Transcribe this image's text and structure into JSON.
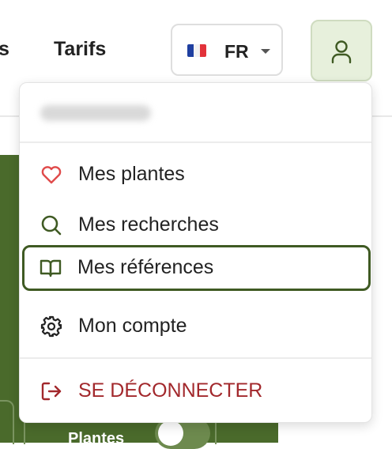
{
  "nav": {
    "partial_label": "s",
    "tarifs_label": "Tarifs"
  },
  "language": {
    "code": "FR"
  },
  "menu": {
    "items": [
      {
        "label": "Mes plantes",
        "icon": "heart-icon"
      },
      {
        "label": "Mes recherches",
        "icon": "search-icon"
      },
      {
        "label": "Mes références",
        "icon": "book-icon"
      },
      {
        "label": "Mon compte",
        "icon": "gear-icon"
      }
    ],
    "logout": {
      "label": "SE DÉCONNECTER",
      "icon": "logout-icon"
    }
  },
  "background": {
    "card_label": "Plantes"
  },
  "colors": {
    "brand_green": "#4a6a2b",
    "accent_dark_green": "#3f5a23",
    "danger_red": "#a2282c",
    "heart_red": "#e04b4b",
    "user_button_bg": "#e7f0dc"
  }
}
